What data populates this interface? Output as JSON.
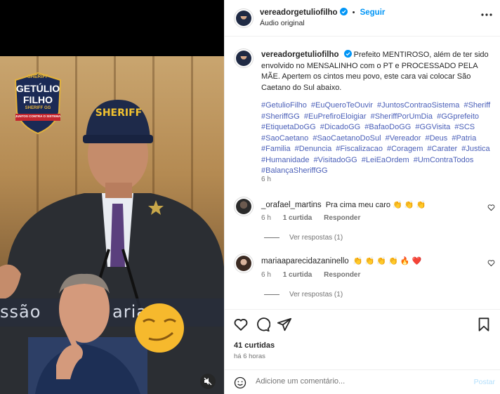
{
  "post": {
    "username": "vereadorgetuliofilho",
    "follow_label": "Seguir",
    "separator": "•",
    "audio_label": "Áudio original",
    "caption": "Prefeito MENTIROSO, além de ter sido envolvido no MENSALINHO com o PT e PROCESSADO PELA MÃE. Apertem os cintos meu povo, este cara vai colocar São Caetano do Sul abaixo.",
    "hashtags": [
      "#GetulioFilho",
      "#EuQueroTeOuvir",
      "#JuntosContraoSistema",
      "#Sheriff",
      "#SheriffGG",
      "#EuPrefiroEloigiar",
      "#SheriffPorUmDia",
      "#GGprefeito",
      "#EtiquetaDoGG",
      "#DicadoGG",
      "#BafaoDoGG",
      "#GGVisita",
      "#SCS",
      "#SaoCaetano",
      "#SaoCaetanoDoSul",
      "#Vereador",
      "#Deus",
      "#Patria",
      "#Familia",
      "#Denuncia",
      "#Fiscalizacao",
      "#Coragem",
      "#Carater",
      "#Justica",
      "#Humanidade",
      "#VisitadoGG",
      "#LeiEaOrdem",
      "#UmContraTodos",
      "#BalançaSheriffGG"
    ],
    "caption_time": "6 h"
  },
  "media": {
    "logo_top": "SHERIFF",
    "logo_name_1": "GETÚLIO",
    "logo_name_2": "FILHO",
    "logo_sub": "SHERIFF GG",
    "logo_banner": "JUNTOS CONTRA O SISTEMA",
    "cap_text": "SHERIFF",
    "plenary_part1": "ssão",
    "plenary_part2": "aria"
  },
  "comments": [
    {
      "user": "_orafael_martins",
      "text": "Pra cima meu caro 👏 👏 👏",
      "time": "6 h",
      "likes": "1 curtida",
      "reply": "Responder",
      "view_replies": "Ver respostas (1)"
    },
    {
      "user": "mariaaparecidazaninello",
      "text": "👏 👏 👏 👏 🔥 ❤️",
      "time": "6 h",
      "likes": "1 curtida",
      "reply": "Responder",
      "view_replies": "Ver respostas (1)"
    }
  ],
  "footer": {
    "likes": "41 curtidas",
    "time_ago": "há 6 horas",
    "comment_placeholder": "Adicione um comentário...",
    "post_label": "Postar"
  },
  "colors": {
    "link_blue": "#0095f6",
    "hashtag": "#4a5fb8",
    "secondary_text": "#737373",
    "verified": "#0095f6"
  },
  "icons": [
    "verified-icon",
    "more-options-icon",
    "heart-icon",
    "comment-icon",
    "share-icon",
    "bookmark-icon",
    "emoji-icon",
    "mute-icon"
  ]
}
